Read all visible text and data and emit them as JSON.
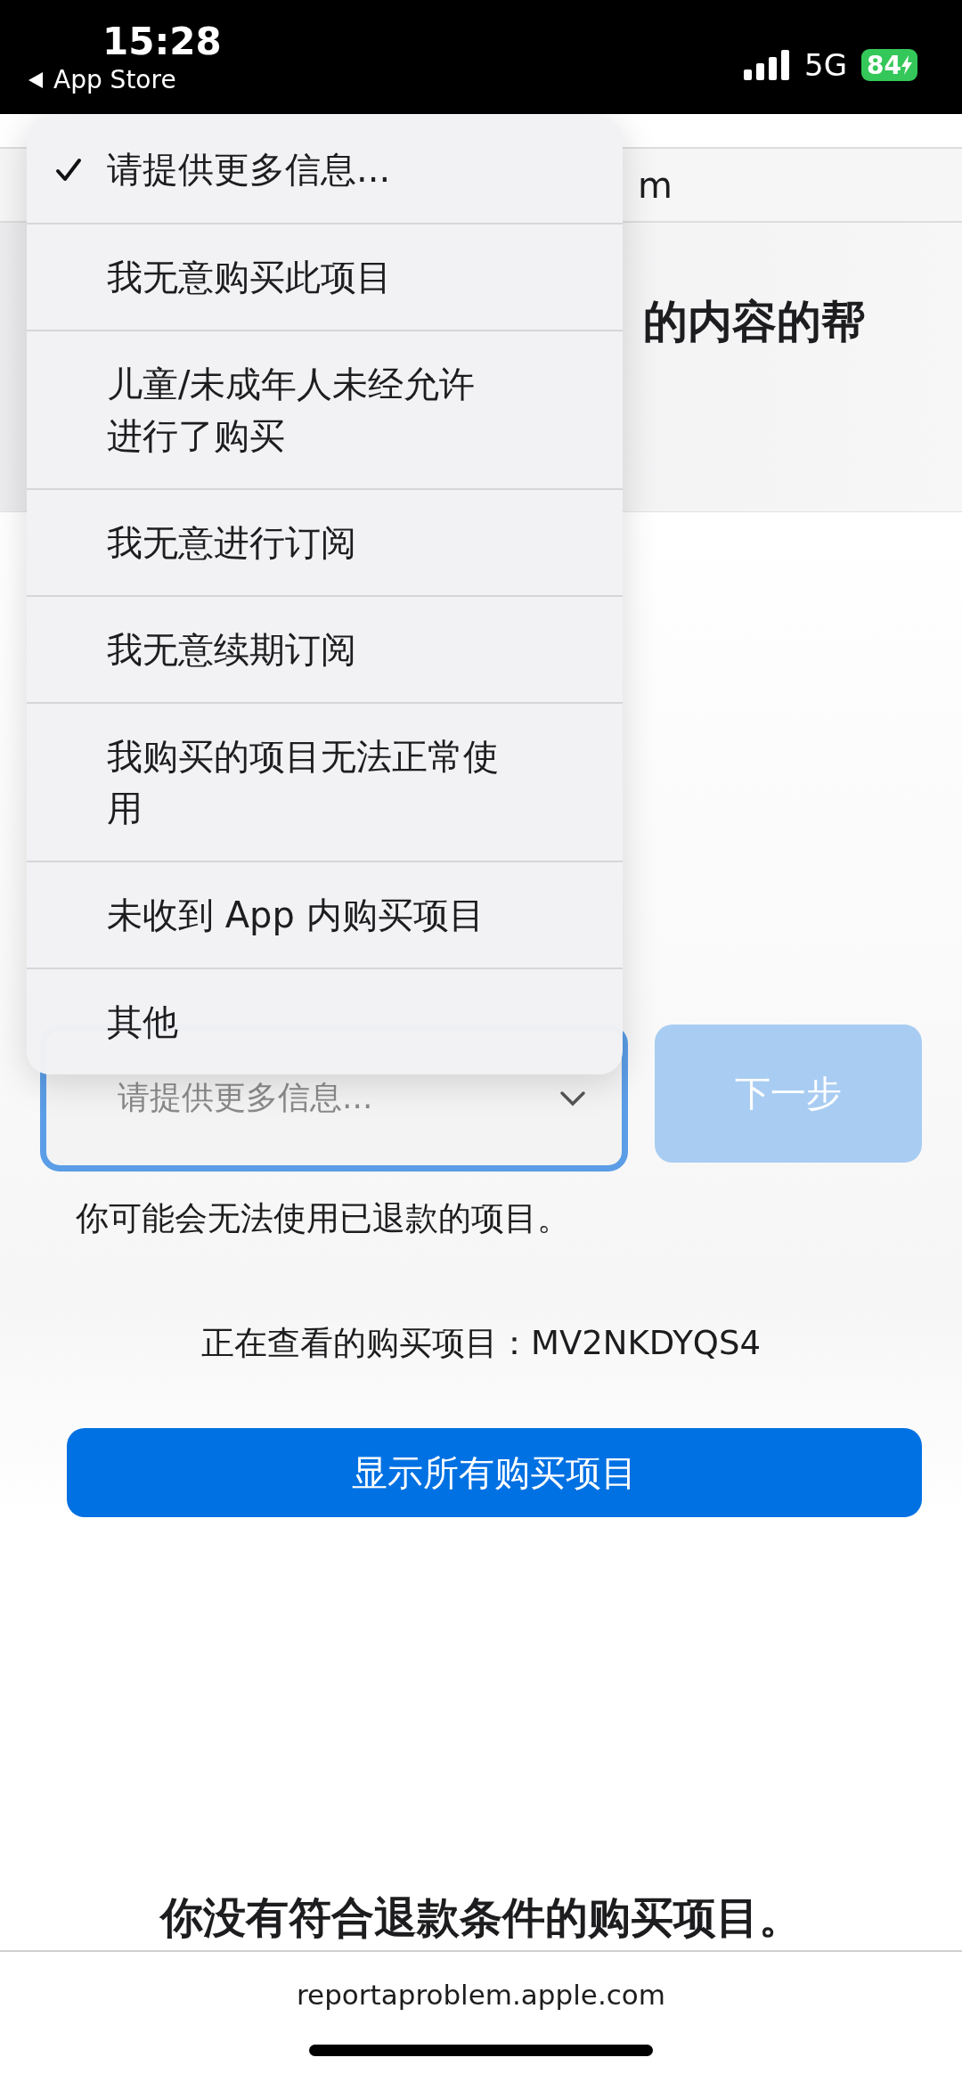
{
  "status_bar": {
    "time": "15:28",
    "back_label": "App Store",
    "network": "5G",
    "battery": "84",
    "charging": true
  },
  "background_page": {
    "url_fragment": "m",
    "heading_fragment": "的内容的帮"
  },
  "reason_menu": {
    "items": [
      {
        "label": "请提供更多信息...",
        "selected": true
      },
      {
        "label": "我无意购买此项目",
        "selected": false
      },
      {
        "label": "儿童/未成年人未经允许进行了购买",
        "selected": false
      },
      {
        "label": "我无意进行订阅",
        "selected": false
      },
      {
        "label": "我无意续期订阅",
        "selected": false
      },
      {
        "label": "我购买的项目无法正常使用",
        "selected": false
      },
      {
        "label": "未收到 App 内购买项目",
        "selected": false
      },
      {
        "label": "其他",
        "selected": false
      }
    ]
  },
  "reason_select": {
    "value": "请提供更多信息..."
  },
  "next_button": {
    "label": "下一步",
    "disabled": true
  },
  "notice": "你可能会无法使用已退款的项目。",
  "viewing": "正在查看的购买项目：MV2NKDYQS4",
  "show_all_button": "显示所有购买项目",
  "no_eligible": "你没有符合退款条件的购买项目。",
  "footer_url": "reportaproblem.apple.com"
}
